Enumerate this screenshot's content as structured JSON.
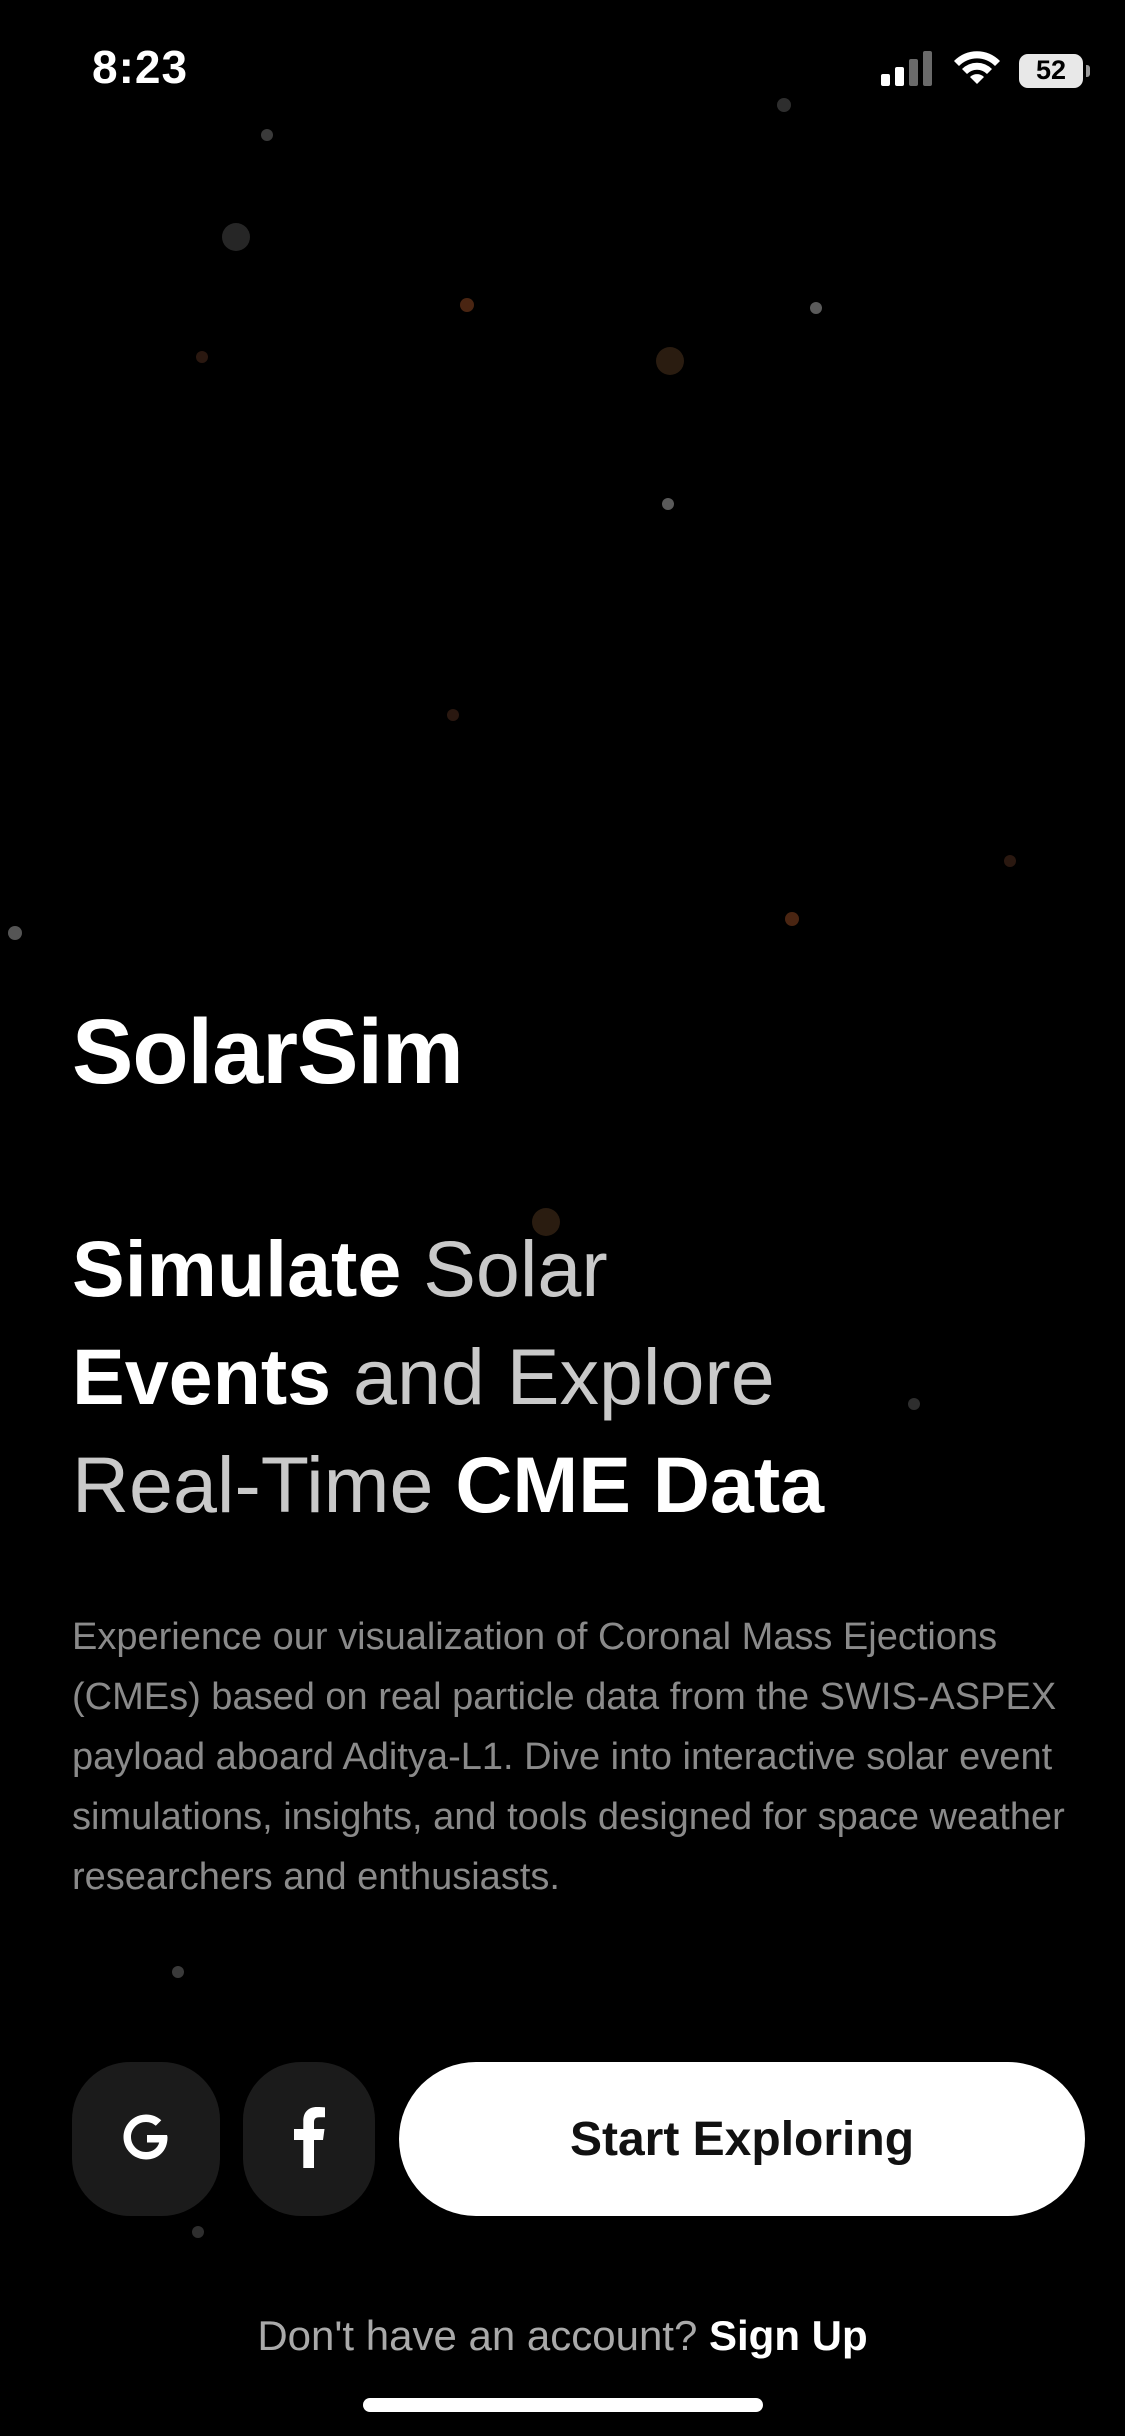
{
  "status_bar": {
    "time": "8:23",
    "battery_level": "52",
    "icons": [
      "cellular-signal-icon",
      "wifi-icon",
      "battery-icon"
    ]
  },
  "app": {
    "title": "SolarSim"
  },
  "headline": {
    "part1_bold": "Simulate",
    "part2": " Solar",
    "part3_bold": "Events",
    "part4": " and Explore",
    "part5": "Real-Time ",
    "part6_bold": "CME Data"
  },
  "description": "Experience our visualization of Coronal Mass Ejections (CMEs) based on real particle data from the SWIS-ASPEX payload aboard Aditya-L1. Dive into interactive solar event simulations, insights, and tools designed for space weather researchers and enthusiasts.",
  "actions": {
    "google_icon": "google-icon",
    "facebook_icon": "facebook-icon",
    "start_label": "Start Exploring"
  },
  "signup": {
    "prompt": "Don't have an account? ",
    "link": "Sign Up"
  },
  "colors": {
    "background": "#000000",
    "primary_button": "#ffffff",
    "social_button": "#1b1b1b",
    "muted_text": "#8a8a8a"
  }
}
